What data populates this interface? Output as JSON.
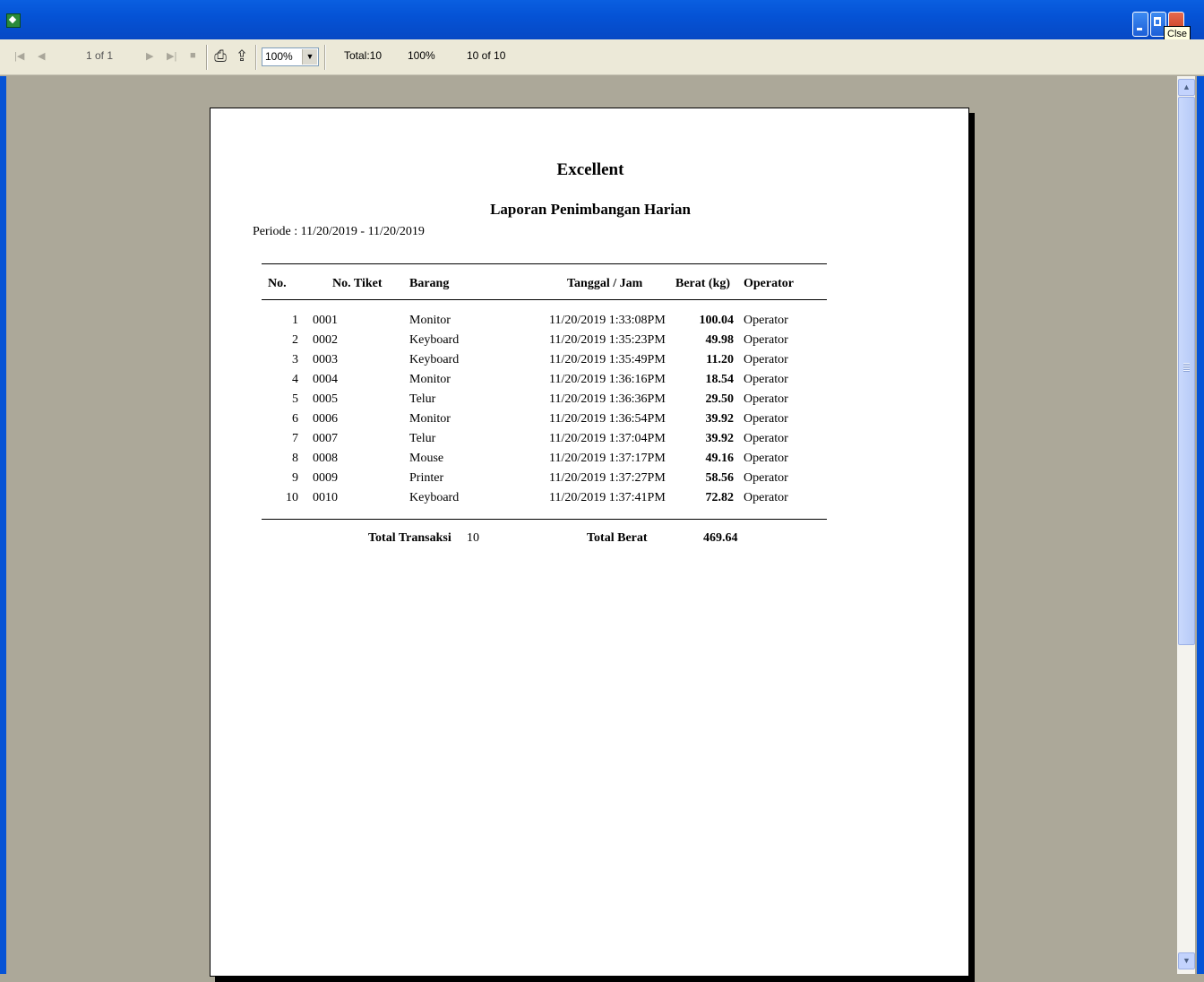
{
  "window": {
    "close_tooltip": "Clse"
  },
  "toolbar": {
    "page_indicator": "1 of 1",
    "zoom_value": "100%",
    "total_label": "Total:10",
    "percent_label": "100%",
    "records_label": "10 of 10"
  },
  "report": {
    "company": "Excellent",
    "title": "Laporan Penimbangan Harian",
    "period": "Periode : 11/20/2019 - 11/20/2019",
    "columns": {
      "no": "No.",
      "tiket": "No. Tiket",
      "barang": "Barang",
      "tanggal": "Tanggal / Jam",
      "berat": "Berat (kg)",
      "operator": "Operator"
    },
    "rows": [
      {
        "no": "1",
        "tiket": "0001",
        "barang": "Monitor",
        "tanggal": "11/20/2019 1:33:08PM",
        "berat": "100.04",
        "operator": "Operator"
      },
      {
        "no": "2",
        "tiket": "0002",
        "barang": "Keyboard",
        "tanggal": "11/20/2019 1:35:23PM",
        "berat": "49.98",
        "operator": "Operator"
      },
      {
        "no": "3",
        "tiket": "0003",
        "barang": "Keyboard",
        "tanggal": "11/20/2019 1:35:49PM",
        "berat": "11.20",
        "operator": "Operator"
      },
      {
        "no": "4",
        "tiket": "0004",
        "barang": "Monitor",
        "tanggal": "11/20/2019 1:36:16PM",
        "berat": "18.54",
        "operator": "Operator"
      },
      {
        "no": "5",
        "tiket": "0005",
        "barang": "Telur",
        "tanggal": "11/20/2019 1:36:36PM",
        "berat": "29.50",
        "operator": "Operator"
      },
      {
        "no": "6",
        "tiket": "0006",
        "barang": "Monitor",
        "tanggal": "11/20/2019 1:36:54PM",
        "berat": "39.92",
        "operator": "Operator"
      },
      {
        "no": "7",
        "tiket": "0007",
        "barang": "Telur",
        "tanggal": "11/20/2019 1:37:04PM",
        "berat": "39.92",
        "operator": "Operator"
      },
      {
        "no": "8",
        "tiket": "0008",
        "barang": "Mouse",
        "tanggal": "11/20/2019 1:37:17PM",
        "berat": "49.16",
        "operator": "Operator"
      },
      {
        "no": "9",
        "tiket": "0009",
        "barang": "Printer",
        "tanggal": "11/20/2019 1:37:27PM",
        "berat": "58.56",
        "operator": "Operator"
      },
      {
        "no": "10",
        "tiket": "0010",
        "barang": "Keyboard",
        "tanggal": "11/20/2019 1:37:41PM",
        "berat": "72.82",
        "operator": "Operator"
      }
    ],
    "footer": {
      "total_transaksi_label": "Total Transaksi",
      "total_transaksi_value": "10",
      "total_berat_label": "Total Berat",
      "total_berat_value": "469.64"
    }
  },
  "colors": {
    "titlebar": "#0553d6",
    "workspace": "#aca899",
    "toolbar": "#ece9d8"
  }
}
